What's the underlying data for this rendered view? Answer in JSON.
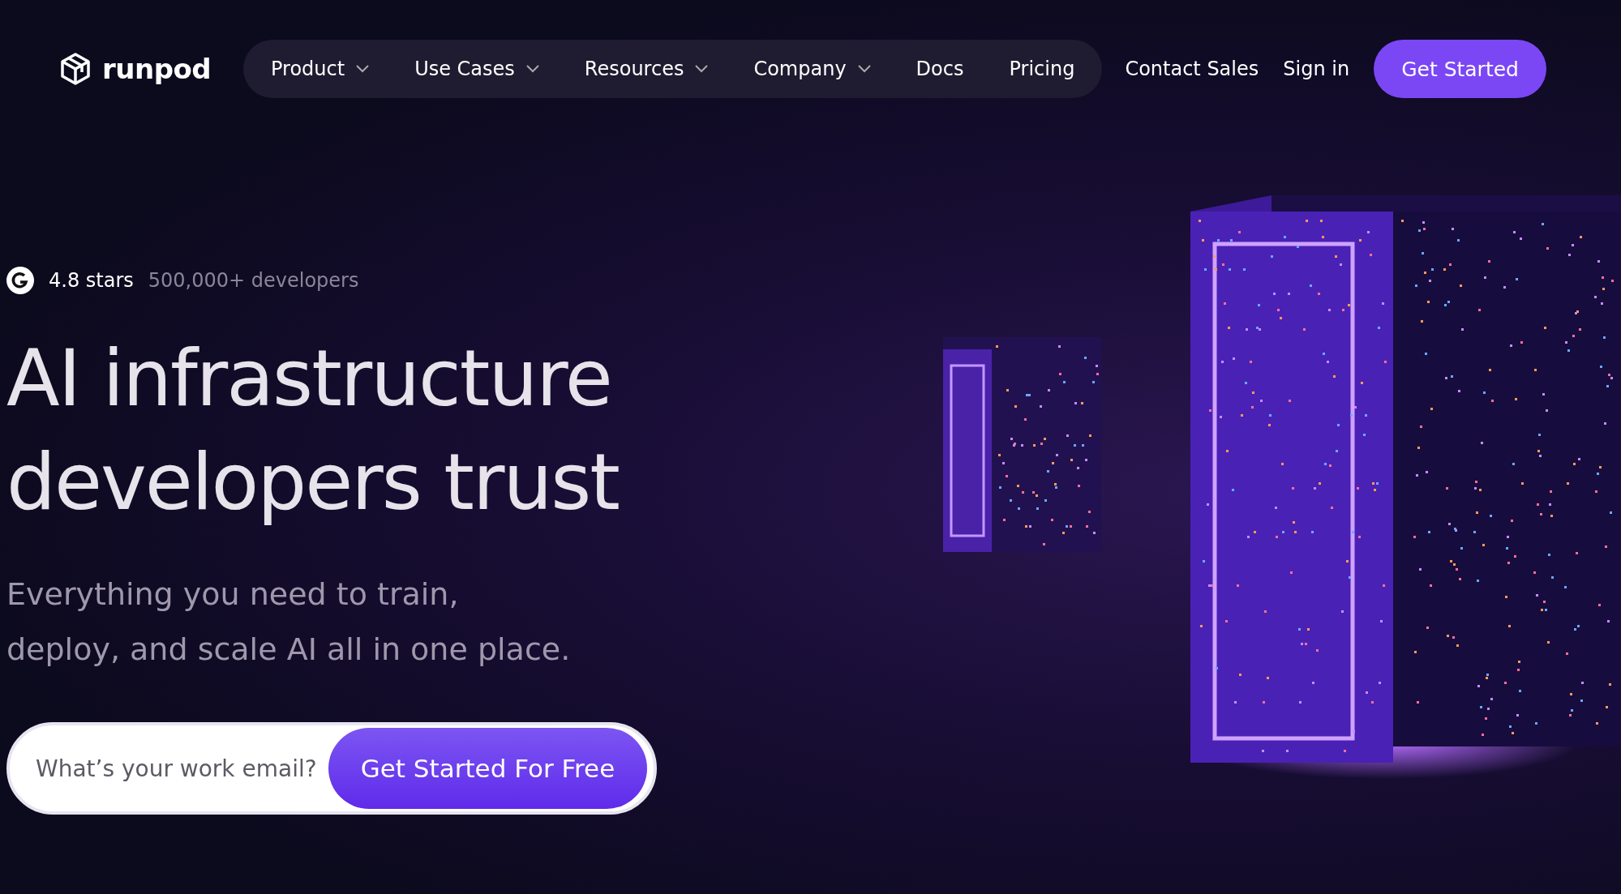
{
  "header": {
    "logo": "runpod",
    "nav": [
      {
        "label": "Product",
        "dropdown": true
      },
      {
        "label": "Use Cases",
        "dropdown": true
      },
      {
        "label": "Resources",
        "dropdown": true
      },
      {
        "label": "Company",
        "dropdown": true
      },
      {
        "label": "Docs",
        "dropdown": false
      },
      {
        "label": "Pricing",
        "dropdown": false
      }
    ],
    "links": [
      "Contact Sales",
      "Sign in"
    ],
    "cta": "Get Started"
  },
  "hero": {
    "rating": "4.8 stars",
    "users": "500,000+ developers",
    "title_lines": [
      "AI infrastructure",
      "developers trust"
    ],
    "subtitle_lines": [
      "Everything you need to train,",
      "deploy, and scale AI all in one place."
    ],
    "email": {
      "placeholder": "What’s your work email?"
    },
    "submit": "Get Started For Free"
  }
}
